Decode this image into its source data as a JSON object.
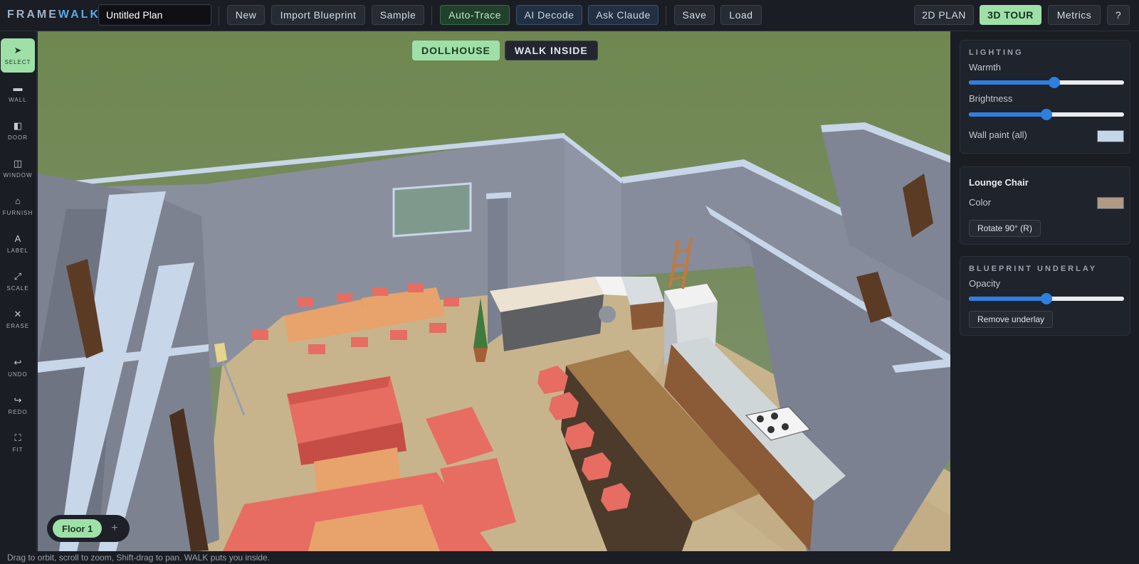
{
  "app": {
    "logo_part1": "FRAME",
    "logo_part2": "WALK",
    "plan_name": "Untitled Plan"
  },
  "toolbar": {
    "new": "New",
    "import": "Import Blueprint",
    "sample": "Sample",
    "auto_trace": "Auto-Trace",
    "ai_decode": "AI Decode",
    "ask_claude": "Ask Claude",
    "save": "Save",
    "load": "Load",
    "view_2d": "2D PLAN",
    "view_3d": "3D TOUR",
    "metrics": "Metrics",
    "help": "?"
  },
  "tools": [
    {
      "label": "SELECT",
      "icon": "arrow-cursor-icon",
      "glyph": "➤"
    },
    {
      "label": "WALL",
      "icon": "wall-icon",
      "glyph": "▬"
    },
    {
      "label": "DOOR",
      "icon": "door-icon",
      "glyph": "◧"
    },
    {
      "label": "WINDOW",
      "icon": "window-icon",
      "glyph": "◫"
    },
    {
      "label": "FURNISH",
      "icon": "furnish-icon",
      "glyph": "⌂"
    },
    {
      "label": "LABEL",
      "icon": "label-icon",
      "glyph": "A"
    },
    {
      "label": "SCALE",
      "icon": "scale-icon",
      "glyph": "⤢"
    },
    {
      "label": "ERASE",
      "icon": "erase-icon",
      "glyph": "✕"
    },
    {
      "label": "UNDO",
      "icon": "undo-icon",
      "glyph": "↩"
    },
    {
      "label": "REDO",
      "icon": "redo-icon",
      "glyph": "↪"
    },
    {
      "label": "FIT",
      "icon": "fit-icon",
      "glyph": "⛶"
    }
  ],
  "viewport": {
    "mode_dollhouse": "DOLLHOUSE",
    "mode_walk": "WALK INSIDE",
    "floor": "Floor 1",
    "add_floor": "+"
  },
  "panel": {
    "lighting": {
      "title": "LIGHTING",
      "warmth_label": "Warmth",
      "warmth": 0.55,
      "brightness_label": "Brightness",
      "brightness": 0.5,
      "wall_paint_label": "Wall paint (all)",
      "wall_paint_color": "#c4d6e8"
    },
    "selection": {
      "title": "Lounge Chair",
      "color_label": "Color",
      "color": "#b09a86",
      "rotate": "Rotate 90° (R)"
    },
    "underlay": {
      "title": "BLUEPRINT UNDERLAY",
      "opacity_label": "Opacity",
      "opacity": 0.5,
      "remove": "Remove underlay"
    }
  },
  "status": "Drag to orbit, scroll to zoom, Shift-drag to pan. WALK puts you inside."
}
